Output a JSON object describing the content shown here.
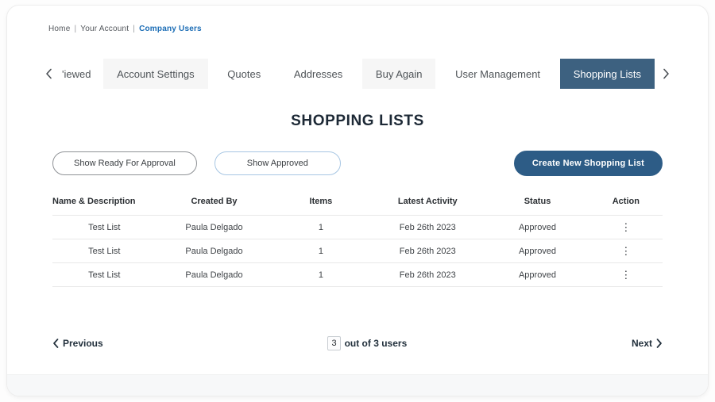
{
  "breadcrumb": {
    "home": "Home",
    "your_account": "Your Account",
    "company_users": "Company Users",
    "separator": "|"
  },
  "tabs": {
    "items": [
      {
        "label": "'iewed"
      },
      {
        "label": "Account Settings"
      },
      {
        "label": "Quotes"
      },
      {
        "label": "Addresses"
      },
      {
        "label": "Buy Again"
      },
      {
        "label": "User Management"
      },
      {
        "label": "Shopping Lists"
      }
    ]
  },
  "page_title": "SHOPPING LISTS",
  "actions": {
    "show_ready_label": "Show Ready For Approval",
    "show_approved_label": "Show Approved",
    "create_label": "Create New Shopping List"
  },
  "table": {
    "columns": [
      "Name & Description",
      "Created By",
      "Items",
      "Latest Activity",
      "Status",
      "Action"
    ],
    "rows": [
      {
        "name": "Test List",
        "created_by": "Paula Delgado",
        "items": "1",
        "latest_activity": "Feb 26th 2023",
        "status": "Approved"
      },
      {
        "name": "Test List",
        "created_by": "Paula Delgado",
        "items": "1",
        "latest_activity": "Feb 26th 2023",
        "status": "Approved"
      },
      {
        "name": "Test List",
        "created_by": "Paula Delgado",
        "items": "1",
        "latest_activity": "Feb 26th 2023",
        "status": "Approved"
      }
    ]
  },
  "pagination": {
    "previous_label": "Previous",
    "page_value": "3",
    "count_label": "out of 3 users",
    "next_label": "Next"
  },
  "icons": {
    "kebab": "⋮"
  },
  "colors": {
    "active_tab": "#3d6180",
    "create_button": "#2d5c86",
    "breadcrumb_link": "#1a6cb5"
  }
}
